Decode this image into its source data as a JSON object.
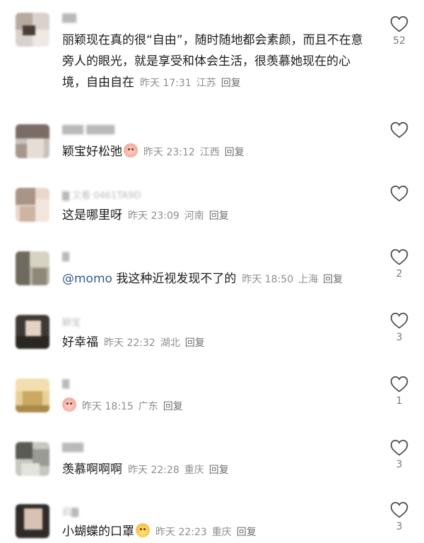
{
  "comments": [
    {
      "username": "▇▇",
      "text": "丽颖现在真的很“自由”，随时随地都会素颜，而且不在意旁人的眼光，就是享受和体会生活，很羡慕她现在的心境，自由自在",
      "mention": "",
      "emoji": false,
      "time": "昨天 17:31",
      "location": "江苏",
      "reply": "回复",
      "likes": "52"
    },
    {
      "username": "▇▇▇ ▇▇▇▇",
      "text": "颖宝好松弛",
      "mention": "",
      "emoji": true,
      "time": "昨天 23:12",
      "location": "江西",
      "reply": "回复",
      "likes": ""
    },
    {
      "username": "▇ 又看 0461TA9D",
      "text": "这是哪里呀",
      "mention": "",
      "emoji": false,
      "time": "昨天 23:09",
      "location": "河南",
      "reply": "回复",
      "likes": ""
    },
    {
      "username": "▇",
      "text": "我这种近视发现不了的",
      "mention": "@momo",
      "emoji": false,
      "time": "昨天 18:50",
      "location": "上海",
      "reply": "回复",
      "likes": "2"
    },
    {
      "username": "颖宝",
      "text": "好幸福",
      "mention": "",
      "emoji": false,
      "time": "昨天 22:32",
      "location": "湖北",
      "reply": "回复",
      "likes": "3"
    },
    {
      "username": "▇",
      "text": "",
      "mention": "",
      "emoji": true,
      "time": "昨天 18:15",
      "location": "广东",
      "reply": "回复",
      "likes": "1"
    },
    {
      "username": "▇▇▇",
      "text": "羡慕啊啊啊",
      "mention": "",
      "emoji": false,
      "time": "昨天 22:28",
      "location": "重庆",
      "reply": "回复",
      "likes": "3"
    },
    {
      "username": "启▇",
      "text": "小蝴蝶的口罩",
      "mention": "",
      "emoji": true,
      "time": "昨天 22:23",
      "location": "重庆",
      "reply": "回复",
      "likes": "3"
    }
  ]
}
